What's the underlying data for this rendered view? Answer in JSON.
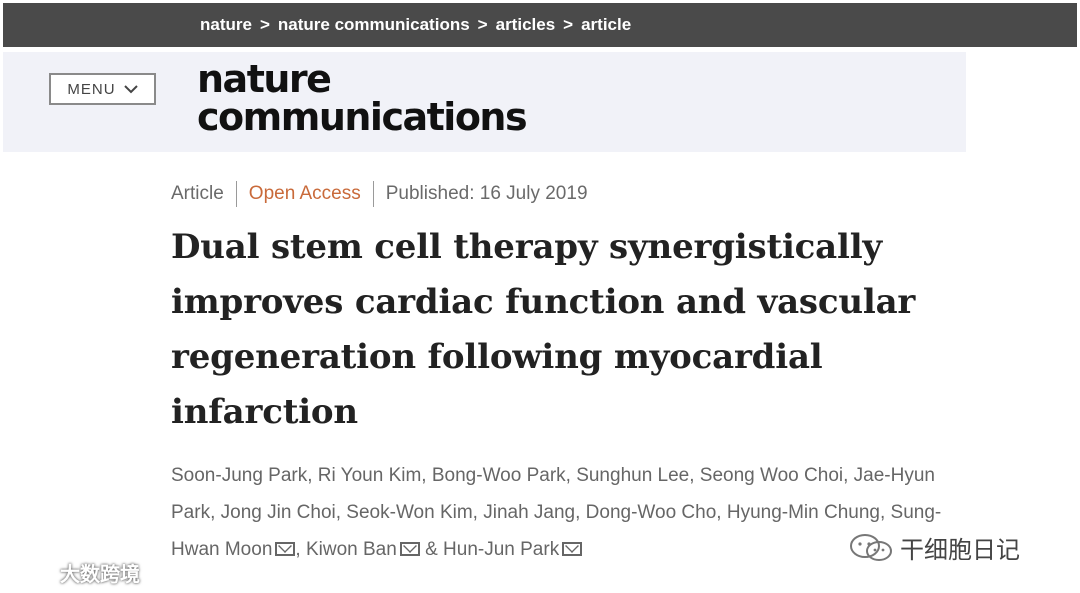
{
  "breadcrumb": {
    "items": [
      "nature",
      "nature communications",
      "articles",
      "article"
    ],
    "separator": ">"
  },
  "header": {
    "menu_label": "MENU",
    "logo_line1": "nature",
    "logo_line2": "communications"
  },
  "article": {
    "type": "Article",
    "access": "Open Access",
    "published": "Published: 16 July 2019",
    "title": "Dual stem cell therapy synergistically improves cardiac function and vascular regeneration following myocardial infarction",
    "authors_part1": "Soon-Jung Park, Ri Youn Kim, Bong-Woo Park, Sunghun Lee, Seong Woo Choi, Jae-Hyun Park, Jong Jin Choi, Seok-Won Kim, Jinah Jang, Dong-Woo Cho, Hyung-Min Chung, Sung-Hwan Moon",
    "authors_part2": ", Kiwon Ban",
    "authors_part3": " & Hun-Jun Park"
  },
  "watermarks": {
    "left": "大数跨境",
    "right": "干细胞日记"
  },
  "colors": {
    "topbar": "#4a4a4a",
    "header_band": "#f1f2f8",
    "open_access": "#c96a3a"
  }
}
